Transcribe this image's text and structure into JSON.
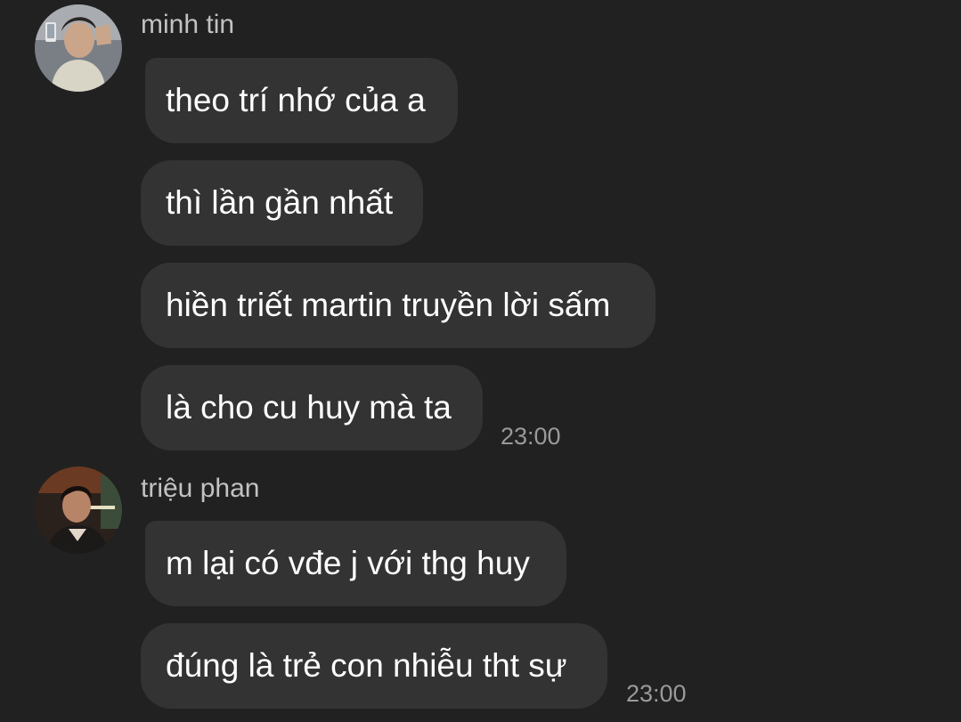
{
  "conversation": {
    "groups": [
      {
        "sender": "minh tin",
        "avatar_icon": "user-avatar-photo",
        "messages": [
          "theo trí nhớ của a",
          "thì lần gần nhất",
          "hiền triết martin truyền lời sấm",
          "là cho cu huy mà ta"
        ],
        "time": "23:00"
      },
      {
        "sender": "triệu phan",
        "avatar_icon": "user-avatar-photo",
        "messages": [
          "m lại có vđe j với thg huy",
          "đúng là trẻ con nhiễu tht sự"
        ],
        "time": "23:00"
      }
    ]
  },
  "colors": {
    "background": "#212121",
    "bubble": "#333333",
    "text": "#ffffff",
    "sender": "#c2c2c2",
    "timestamp": "#9a9a9a"
  }
}
